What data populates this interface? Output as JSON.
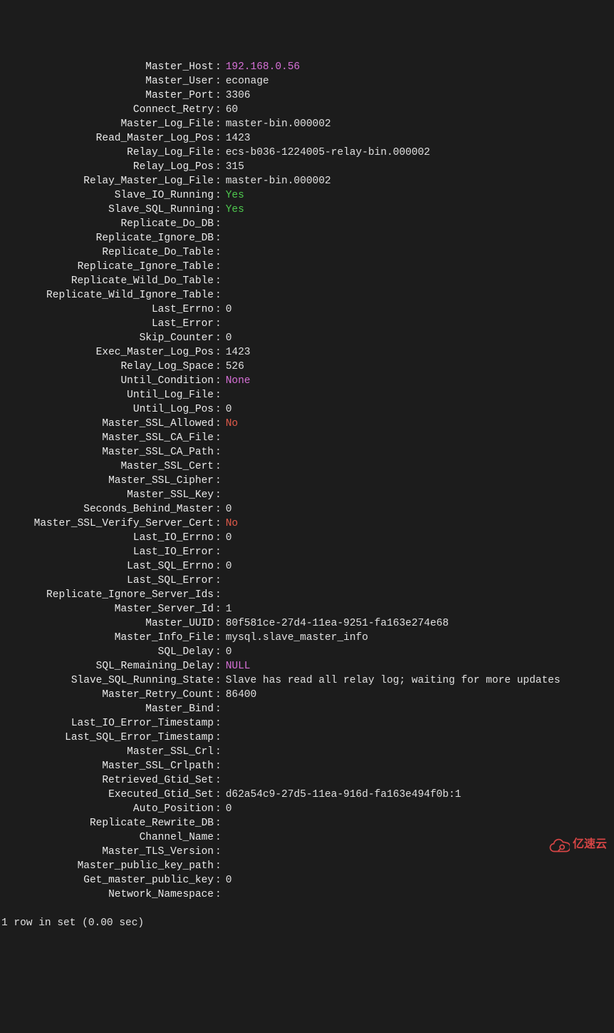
{
  "rows": [
    {
      "label": "Master_Host",
      "value": "192.168.0.56",
      "cls": "magenta"
    },
    {
      "label": "Master_User",
      "value": "econage"
    },
    {
      "label": "Master_Port",
      "value": "3306"
    },
    {
      "label": "Connect_Retry",
      "value": "60"
    },
    {
      "label": "Master_Log_File",
      "value": "master-bin.000002"
    },
    {
      "label": "Read_Master_Log_Pos",
      "value": "1423"
    },
    {
      "label": "Relay_Log_File",
      "value": "ecs-b036-1224005-relay-bin.000002"
    },
    {
      "label": "Relay_Log_Pos",
      "value": "315"
    },
    {
      "label": "Relay_Master_Log_File",
      "value": "master-bin.000002"
    },
    {
      "label": "Slave_IO_Running",
      "value": "Yes",
      "cls": "green"
    },
    {
      "label": "Slave_SQL_Running",
      "value": "Yes",
      "cls": "green"
    },
    {
      "label": "Replicate_Do_DB",
      "value": ""
    },
    {
      "label": "Replicate_Ignore_DB",
      "value": ""
    },
    {
      "label": "Replicate_Do_Table",
      "value": ""
    },
    {
      "label": "Replicate_Ignore_Table",
      "value": ""
    },
    {
      "label": "Replicate_Wild_Do_Table",
      "value": ""
    },
    {
      "label": "Replicate_Wild_Ignore_Table",
      "value": ""
    },
    {
      "label": "Last_Errno",
      "value": "0"
    },
    {
      "label": "Last_Error",
      "value": ""
    },
    {
      "label": "Skip_Counter",
      "value": "0"
    },
    {
      "label": "Exec_Master_Log_Pos",
      "value": "1423"
    },
    {
      "label": "Relay_Log_Space",
      "value": "526"
    },
    {
      "label": "Until_Condition",
      "value": "None",
      "cls": "magenta"
    },
    {
      "label": "Until_Log_File",
      "value": ""
    },
    {
      "label": "Until_Log_Pos",
      "value": "0"
    },
    {
      "label": "Master_SSL_Allowed",
      "value": "No",
      "cls": "red"
    },
    {
      "label": "Master_SSL_CA_File",
      "value": ""
    },
    {
      "label": "Master_SSL_CA_Path",
      "value": ""
    },
    {
      "label": "Master_SSL_Cert",
      "value": ""
    },
    {
      "label": "Master_SSL_Cipher",
      "value": ""
    },
    {
      "label": "Master_SSL_Key",
      "value": ""
    },
    {
      "label": "Seconds_Behind_Master",
      "value": "0"
    },
    {
      "label": "Master_SSL_Verify_Server_Cert",
      "value": "No",
      "cls": "red"
    },
    {
      "label": "Last_IO_Errno",
      "value": "0"
    },
    {
      "label": "Last_IO_Error",
      "value": ""
    },
    {
      "label": "Last_SQL_Errno",
      "value": "0"
    },
    {
      "label": "Last_SQL_Error",
      "value": ""
    },
    {
      "label": "Replicate_Ignore_Server_Ids",
      "value": ""
    },
    {
      "label": "Master_Server_Id",
      "value": "1"
    },
    {
      "label": "Master_UUID",
      "value": "80f581ce-27d4-11ea-9251-fa163e274e68"
    },
    {
      "label": "Master_Info_File",
      "value": "mysql.slave_master_info"
    },
    {
      "label": "SQL_Delay",
      "value": "0"
    },
    {
      "label": "SQL_Remaining_Delay",
      "value": "NULL",
      "cls": "magenta"
    },
    {
      "label": "Slave_SQL_Running_State",
      "value": "Slave has read all relay log; waiting for more updates"
    },
    {
      "label": "Master_Retry_Count",
      "value": "86400"
    },
    {
      "label": "Master_Bind",
      "value": ""
    },
    {
      "label": "Last_IO_Error_Timestamp",
      "value": ""
    },
    {
      "label": "Last_SQL_Error_Timestamp",
      "value": ""
    },
    {
      "label": "Master_SSL_Crl",
      "value": ""
    },
    {
      "label": "Master_SSL_Crlpath",
      "value": ""
    },
    {
      "label": "Retrieved_Gtid_Set",
      "value": ""
    },
    {
      "label": "Executed_Gtid_Set",
      "value": "d62a54c9-27d5-11ea-916d-fa163e494f0b:1"
    },
    {
      "label": "Auto_Position",
      "value": "0"
    },
    {
      "label": "Replicate_Rewrite_DB",
      "value": ""
    },
    {
      "label": "Channel_Name",
      "value": ""
    },
    {
      "label": "Master_TLS_Version",
      "value": ""
    },
    {
      "label": "Master_public_key_path",
      "value": ""
    },
    {
      "label": "Get_master_public_key",
      "value": "0"
    },
    {
      "label": "Network_Namespace",
      "value": ""
    }
  ],
  "footer": "1 row in set (0.00 sec)",
  "watermark": "亿速云"
}
